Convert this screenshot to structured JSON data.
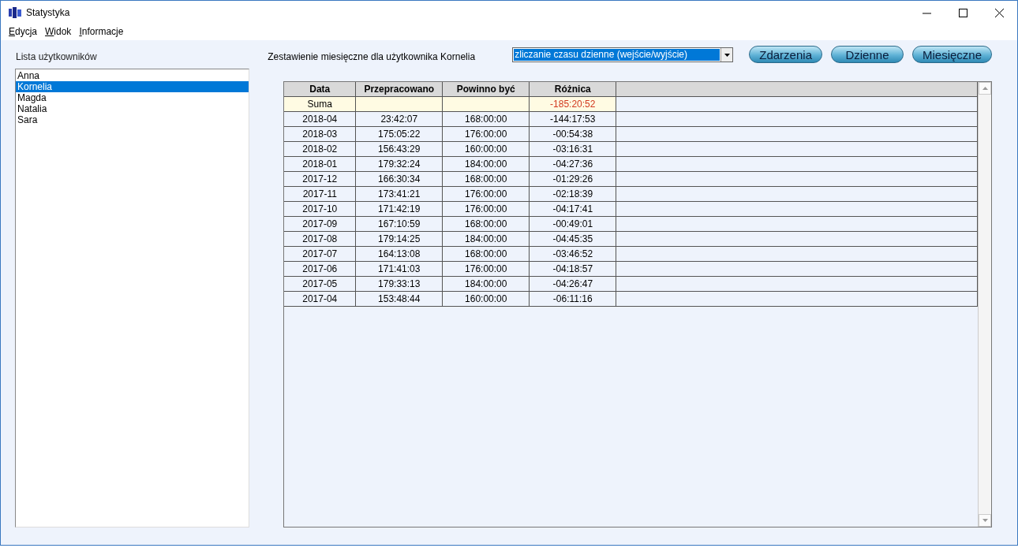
{
  "window": {
    "title": "Statystyka"
  },
  "menu": [
    "Edycja",
    "Widok",
    "Informacje"
  ],
  "users": {
    "label": "Lista użytkowników",
    "items": [
      {
        "name": "Anna",
        "selected": false
      },
      {
        "name": "Kornelia",
        "selected": true
      },
      {
        "name": "Magda",
        "selected": false
      },
      {
        "name": "Natalia",
        "selected": false
      },
      {
        "name": "Sara",
        "selected": false
      }
    ]
  },
  "report": {
    "heading": "Zestawienie miesięczne dla użytkownika Kornelia",
    "mode": {
      "value": "zliczanie czasu dzienne (wejście/wyjście)"
    },
    "buttons": [
      "Zdarzenia",
      "Dzienne",
      "Miesięczne"
    ]
  },
  "table": {
    "columns": [
      "Data",
      "Przepracowano",
      "Powinno być",
      "Różnica"
    ],
    "summary": {
      "label": "Suma",
      "difference": "-185:20:52"
    },
    "rows": [
      [
        "2018-04",
        "23:42:07",
        "168:00:00",
        "-144:17:53"
      ],
      [
        "2018-03",
        "175:05:22",
        "176:00:00",
        "-00:54:38"
      ],
      [
        "2018-02",
        "156:43:29",
        "160:00:00",
        "-03:16:31"
      ],
      [
        "2018-01",
        "179:32:24",
        "184:00:00",
        "-04:27:36"
      ],
      [
        "2017-12",
        "166:30:34",
        "168:00:00",
        "-01:29:26"
      ],
      [
        "2017-11",
        "173:41:21",
        "176:00:00",
        "-02:18:39"
      ],
      [
        "2017-10",
        "171:42:19",
        "176:00:00",
        "-04:17:41"
      ],
      [
        "2017-09",
        "167:10:59",
        "168:00:00",
        "-00:49:01"
      ],
      [
        "2017-08",
        "179:14:25",
        "184:00:00",
        "-04:45:35"
      ],
      [
        "2017-07",
        "164:13:08",
        "168:00:00",
        "-03:46:52"
      ],
      [
        "2017-06",
        "171:41:03",
        "176:00:00",
        "-04:18:57"
      ],
      [
        "2017-05",
        "179:33:13",
        "184:00:00",
        "-04:26:47"
      ],
      [
        "2017-04",
        "153:48:44",
        "160:00:00",
        "-06:11:16"
      ]
    ]
  }
}
